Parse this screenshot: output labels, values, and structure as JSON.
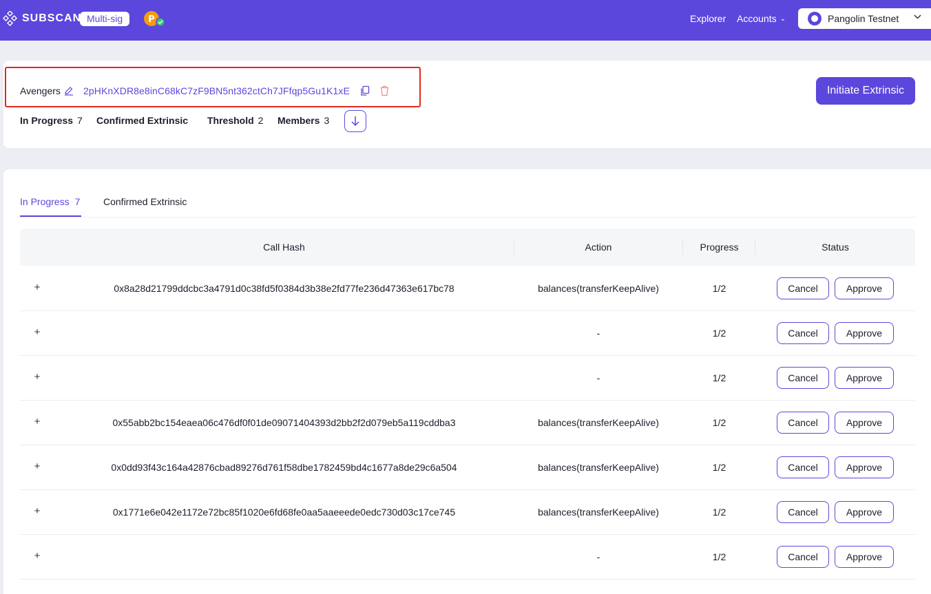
{
  "header": {
    "logo_text": "SUBSCAN",
    "badge": "Multi-sig",
    "nav_explorer": "Explorer",
    "nav_accounts": "Accounts",
    "network": "Pangolin Testnet",
    "brand_color": "#5b47dc"
  },
  "account": {
    "name": "Avengers",
    "address": "2pHKnXDR8e8inC68kC7zF9BN5nt362ctCh7JFfqp5Gu1K1xE",
    "initiate_label": "Initiate Extrinsic",
    "stats": {
      "in_progress_label": "In Progress",
      "in_progress_value": "7",
      "confirmed_label": "Confirmed Extrinsic",
      "threshold_label": "Threshold",
      "threshold_value": "2",
      "members_label": "Members",
      "members_value": "3"
    }
  },
  "tabs": {
    "active_label": "In Progress",
    "active_count": "7",
    "inactive_label": "Confirmed Extrinsic"
  },
  "table": {
    "headers": {
      "call_hash": "Call Hash",
      "action": "Action",
      "progress": "Progress",
      "status": "Status"
    },
    "cancel_label": "Cancel",
    "approve_label": "Approve",
    "rows": [
      {
        "hash": "0x8a28d21799ddcbc3a4791d0c38fd5f0384d3b38e2fd77fe236d47363e617bc78",
        "action": "balances(transferKeepAlive)",
        "progress": "1/2"
      },
      {
        "hash": "",
        "action": "-",
        "progress": "1/2"
      },
      {
        "hash": "",
        "action": "-",
        "progress": "1/2"
      },
      {
        "hash": "0x55abb2bc154eaea06c476df0f01de09071404393d2bb2f2d079eb5a119cddba3",
        "action": "balances(transferKeepAlive)",
        "progress": "1/2"
      },
      {
        "hash": "0x0dd93f43c164a42876cbad89276d761f58dbe1782459bd4c1677a8de29c6a504",
        "action": "balances(transferKeepAlive)",
        "progress": "1/2"
      },
      {
        "hash": "0x1771e6e042e1172e72bc85f1020e6fd68fe0aa5aaeeede0edc730d03c17ce745",
        "action": "balances(transferKeepAlive)",
        "progress": "1/2"
      },
      {
        "hash": "",
        "action": "-",
        "progress": "1/2"
      }
    ]
  }
}
